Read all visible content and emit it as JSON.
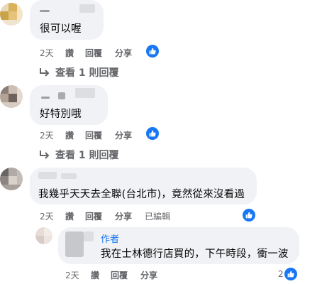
{
  "comments": [
    {
      "text": "很可以喔",
      "time": "2天",
      "like_label": "讚",
      "reply_label": "回覆",
      "share_label": "分享",
      "view_replies": "查看 1 則回覆",
      "reaction_icon": "thumbs-up-icon"
    },
    {
      "text": "好特別哦",
      "time": "2天",
      "like_label": "讚",
      "reply_label": "回覆",
      "share_label": "分享",
      "view_replies": "查看 1 則回覆",
      "reaction_icon": "thumbs-up-icon"
    },
    {
      "text": "我幾乎天天去全聯(台北市)，竟然從來沒看過",
      "time": "2天",
      "like_label": "讚",
      "reply_label": "回覆",
      "share_label": "分享",
      "edited_label": "已編輯",
      "reaction_icon": "thumbs-up-icon"
    }
  ],
  "reply": {
    "author_badge": "作者",
    "text": "我在士林德行店買的，下午時段，衝一波",
    "time": "2天",
    "like_label": "讚",
    "reply_label": "回覆",
    "share_label": "分享",
    "reaction_count": "2",
    "reaction_icon": "thumbs-up-icon"
  },
  "colors": {
    "bubble": "#f0f2f5",
    "meta_text": "#65676b",
    "accent": "#1877f2"
  }
}
